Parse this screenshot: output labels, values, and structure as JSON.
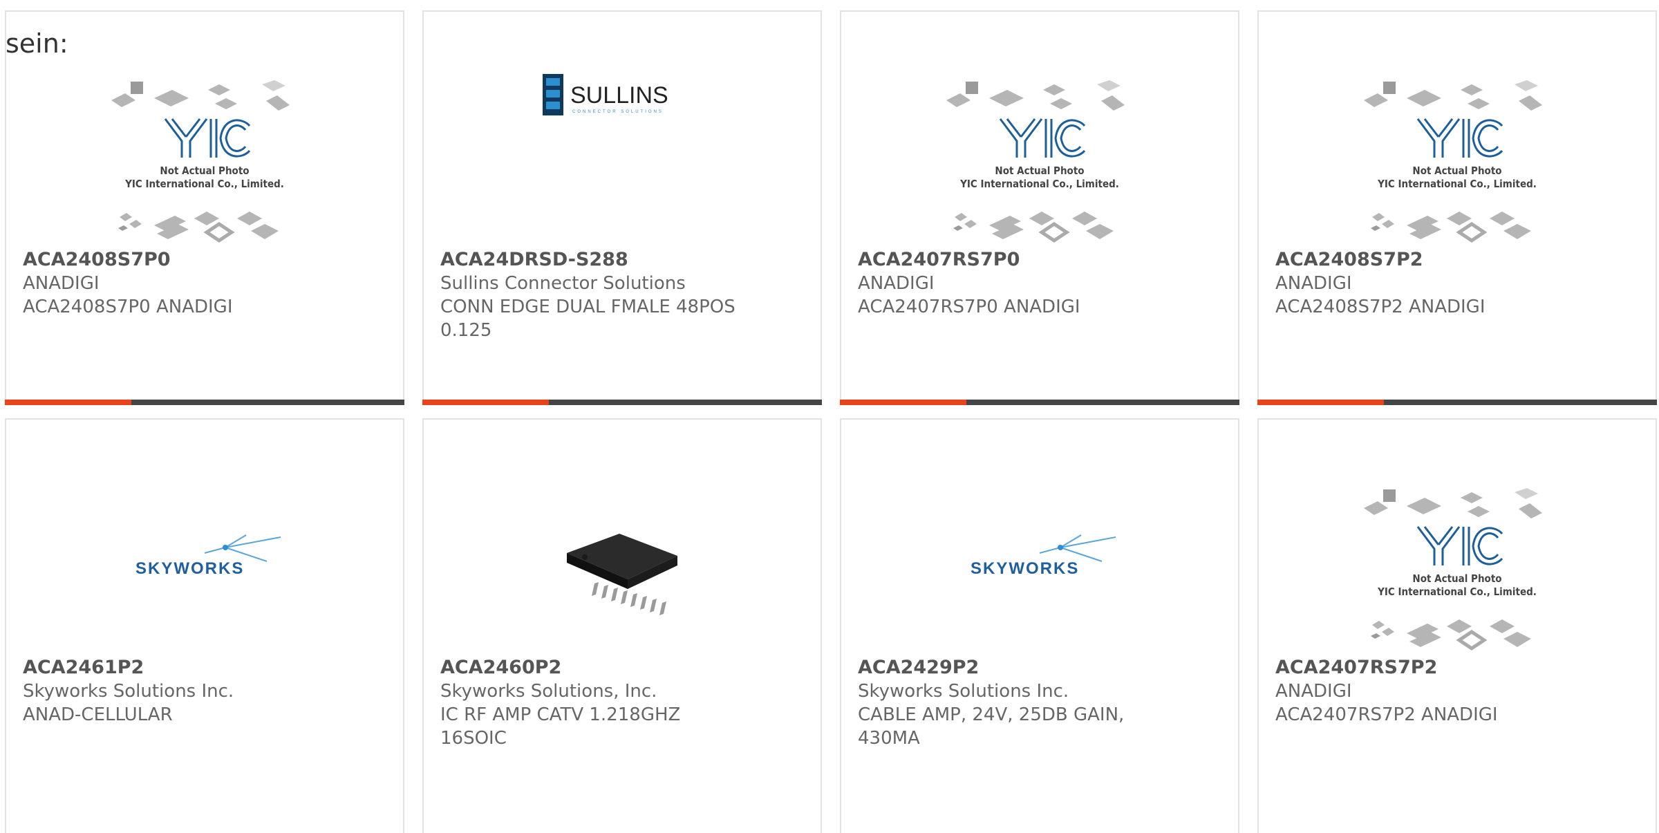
{
  "page": {
    "fragment_text": "sein:"
  },
  "colors": {
    "accent": "#e8431a",
    "bar": "#454545",
    "border": "#e2e2e2",
    "text": "#666666"
  },
  "placeholder": {
    "line1": "Not Actual Photo",
    "line2": "YIC International Co., Limited.",
    "logo": "YIC"
  },
  "products": [
    {
      "part_no": "ACA2408S7P0",
      "manufacturer": "ANADIGI",
      "desc1": "ACA2408S7P0 ANADIGI",
      "desc2": "",
      "image": "yic-placeholder"
    },
    {
      "part_no": "ACA24DRSD-S288",
      "manufacturer": "Sullins Connector Solutions",
      "desc1": "CONN EDGE DUAL FMALE 48POS",
      "desc2": "0.125",
      "image": "sullins-logo",
      "logo_text": "SULLINS",
      "logo_sub": "CONNECTOR SOLUTIONS"
    },
    {
      "part_no": "ACA2407RS7P0",
      "manufacturer": "ANADIGI",
      "desc1": "ACA2407RS7P0 ANADIGI",
      "desc2": "",
      "image": "yic-placeholder"
    },
    {
      "part_no": "ACA2408S7P2",
      "manufacturer": "ANADIGI",
      "desc1": "ACA2408S7P2 ANADIGI",
      "desc2": "",
      "image": "yic-placeholder"
    },
    {
      "part_no": "ACA2461P2",
      "manufacturer": "Skyworks Solutions Inc.",
      "desc1": "ANAD-CELLULAR",
      "desc2": "",
      "image": "skyworks-logo",
      "logo_text": "SKYWORKS"
    },
    {
      "part_no": "ACA2460P2",
      "manufacturer": "Skyworks Solutions, Inc.",
      "desc1": "IC RF AMP CATV 1.218GHZ",
      "desc2": "16SOIC",
      "image": "soic-chip"
    },
    {
      "part_no": "ACA2429P2",
      "manufacturer": "Skyworks Solutions Inc.",
      "desc1": "CABLE AMP, 24V, 25DB GAIN,",
      "desc2": "430MA",
      "image": "skyworks-logo",
      "logo_text": "SKYWORKS"
    },
    {
      "part_no": "ACA2407RS7P2",
      "manufacturer": "ANADIGI",
      "desc1": "ACA2407RS7P2 ANADIGI",
      "desc2": "",
      "image": "yic-placeholder"
    }
  ]
}
